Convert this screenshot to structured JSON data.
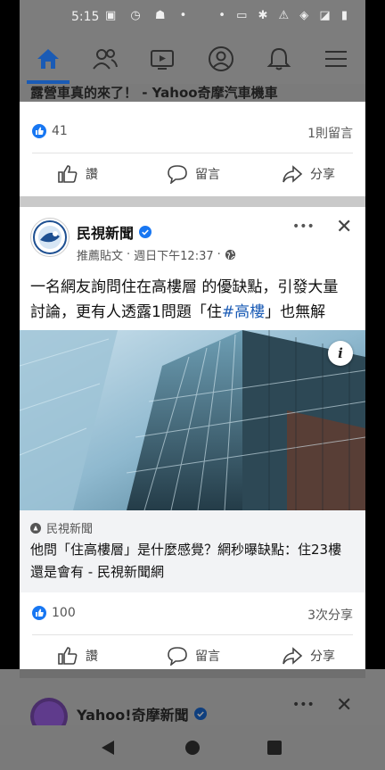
{
  "status_bar": {
    "time": "5:15"
  },
  "nav": {
    "items": [
      "home",
      "friends",
      "watch",
      "profile",
      "notifications",
      "menu"
    ]
  },
  "post1": {
    "headline": "露營車真的來了！ - Yahoo奇摩汽車機車",
    "likes": "41",
    "comments": "1則留言",
    "actions": {
      "like": "讚",
      "comment": "留言",
      "share": "分享"
    }
  },
  "post2": {
    "page_name": "民視新聞",
    "sponsored": "推薦貼文",
    "time": "週日下午12:37",
    "dot": "·",
    "text_before": "一名網友詢問住在高樓層 的優缺點，引發大量討論，更有人透露1問題「住",
    "hashtag": "#高樓",
    "text_after": "」也無解",
    "link_source": "民視新聞",
    "link_title": "他問「住高樓層」是什麼感覺？網秒曝缺點：住23樓還是會有 - 民視新聞網",
    "likes": "100",
    "shares": "3次分享",
    "actions": {
      "like": "讚",
      "comment": "留言",
      "share": "分享"
    },
    "info_label": "i",
    "more": "•••",
    "close": "✕"
  },
  "post3": {
    "page_name": "Yahoo!奇摩新聞",
    "more": "•••",
    "close": "✕"
  },
  "colors": {
    "facebook_blue": "#1877f2",
    "dim_gray": "#7d7d7d"
  }
}
